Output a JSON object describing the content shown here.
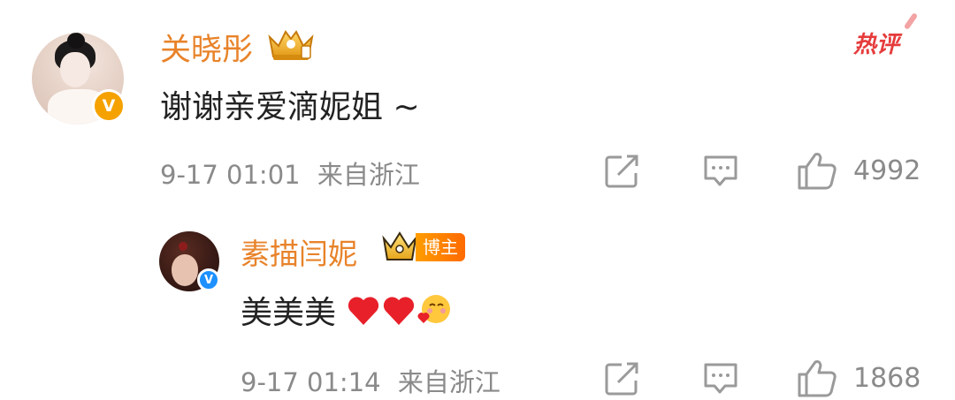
{
  "main_comment": {
    "username": "关晓彤",
    "text": "谢谢亲爱滴妮姐 ~",
    "time": "9-17 01:01",
    "location": "来自浙江",
    "likes": "4992",
    "hot_tag": "热评",
    "badge_icon": "crown-badge-icon",
    "verified_icon": "verified-v-orange-icon"
  },
  "reply": {
    "username": "素描闫妮",
    "blogger_tag": "博主",
    "text": "美美美",
    "time": "9-17 01:14",
    "location": "来自浙江",
    "likes": "1868",
    "badge_icon": "crown-badge-icon",
    "verified_icon": "verified-v-blue-icon",
    "emojis": [
      "heart-emoji",
      "heart-emoji",
      "love-face-emoji"
    ]
  },
  "colors": {
    "username": "#e8832a",
    "meta": "#8a8a8a",
    "hot_tag": "#e63b3b",
    "verified_orange": "#f5a200",
    "verified_blue": "#1e90ff",
    "heart": "#e8202a"
  }
}
